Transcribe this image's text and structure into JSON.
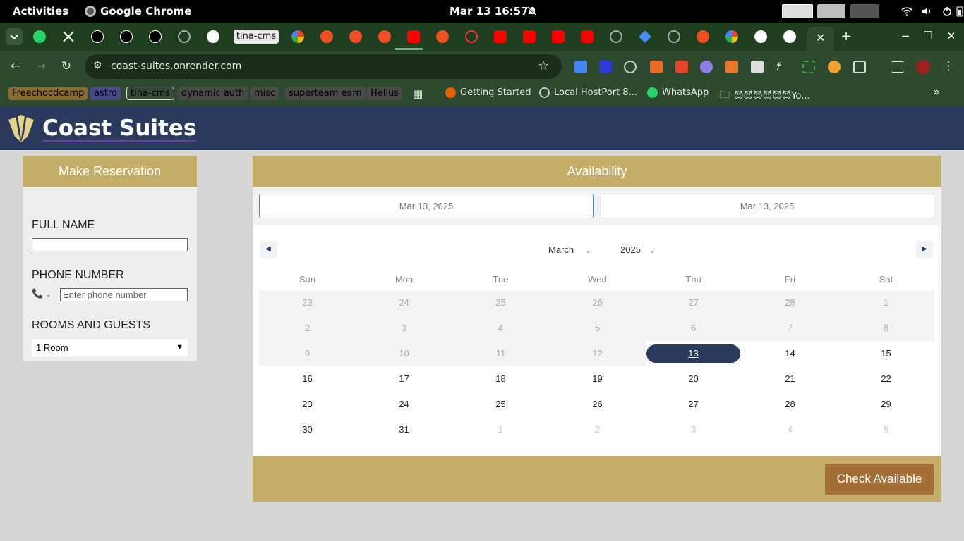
{
  "system": {
    "activities": "Activities",
    "app_name": "Google Chrome",
    "clock": "Mar 13  16:57"
  },
  "browser": {
    "pinned_tab_label": "tina-cms",
    "url": "coast-suites.onrender.com",
    "bookmarks": {
      "chips": [
        "Freechocdcamp",
        "astro",
        "tina-cms",
        "dynamic auth",
        "misc",
        "superteam earn",
        "Helius"
      ],
      "links": [
        "Getting Started",
        "Local HostPort 8...",
        "WhatsApp",
        "😈😈😈😈😈😈Yo..."
      ],
      "more": "»"
    }
  },
  "site": {
    "title": "Coast Suites"
  },
  "reservation": {
    "heading": "Make Reservation",
    "full_name_label": "FULL NAME",
    "full_name_value": "",
    "phone_label": "PHONE NUMBER",
    "phone_placeholder": "Enter phone number",
    "rooms_label": "ROOMS AND GUESTS",
    "rooms_value": "1 Room"
  },
  "availability": {
    "heading": "Availability",
    "check_in": "Mar 13, 2025",
    "check_out": "Mar 13, 2025",
    "month": "March",
    "year": "2025",
    "weekdays": [
      "Sun",
      "Mon",
      "Tue",
      "Wed",
      "Thu",
      "Fri",
      "Sat"
    ],
    "weeks": [
      [
        "23",
        "24",
        "25",
        "26",
        "27",
        "28",
        "1"
      ],
      [
        "2",
        "3",
        "4",
        "5",
        "6",
        "7",
        "8"
      ],
      [
        "9",
        "10",
        "11",
        "12",
        "13",
        "14",
        "15"
      ],
      [
        "16",
        "17",
        "18",
        "19",
        "20",
        "21",
        "22"
      ],
      [
        "23",
        "24",
        "25",
        "26",
        "27",
        "28",
        "29"
      ],
      [
        "30",
        "31",
        "1",
        "2",
        "3",
        "4",
        "5"
      ]
    ],
    "selected_day": "13",
    "check_button": "Check Available"
  },
  "colors": {
    "header_navy": "#2b3a5c",
    "gold": "#c4ad66",
    "button_brown": "#a36f36"
  }
}
